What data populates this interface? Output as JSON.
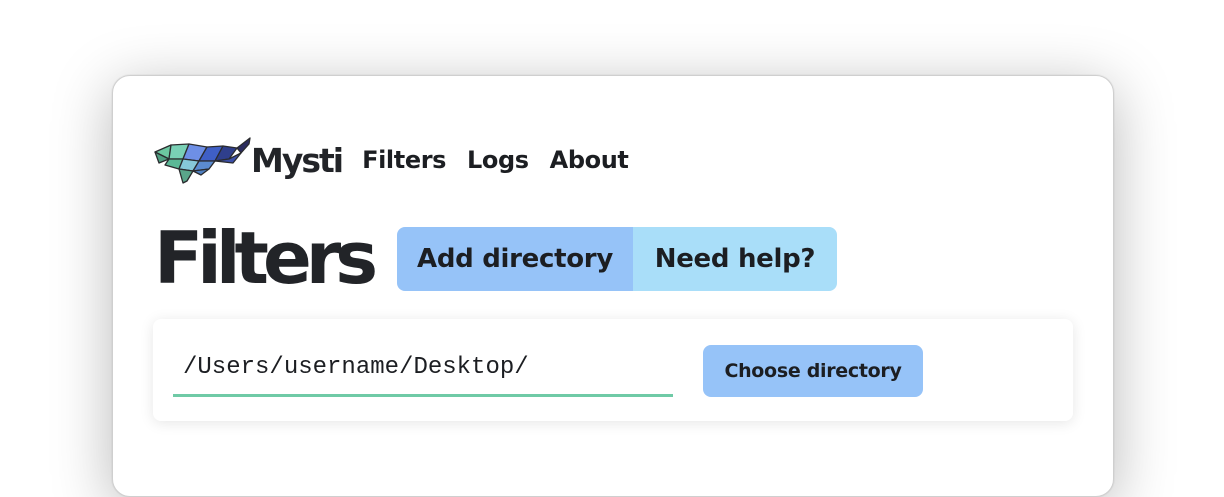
{
  "app": {
    "brand_name": "Mysti",
    "logo_icon": "whale-icon"
  },
  "nav": {
    "items": [
      {
        "label": "Filters"
      },
      {
        "label": "Logs"
      },
      {
        "label": "About"
      }
    ]
  },
  "page": {
    "title": "Filters",
    "actions": {
      "add_directory_label": "Add directory",
      "need_help_label": "Need help?"
    }
  },
  "directory_card": {
    "input_value": "/Users/username/Desktop/",
    "choose_button_label": "Choose directory"
  },
  "colors": {
    "primary_button": "#96c3f8",
    "secondary_button": "#a9def9",
    "input_underline": "#6fcaa6",
    "text": "#1c1e22"
  }
}
